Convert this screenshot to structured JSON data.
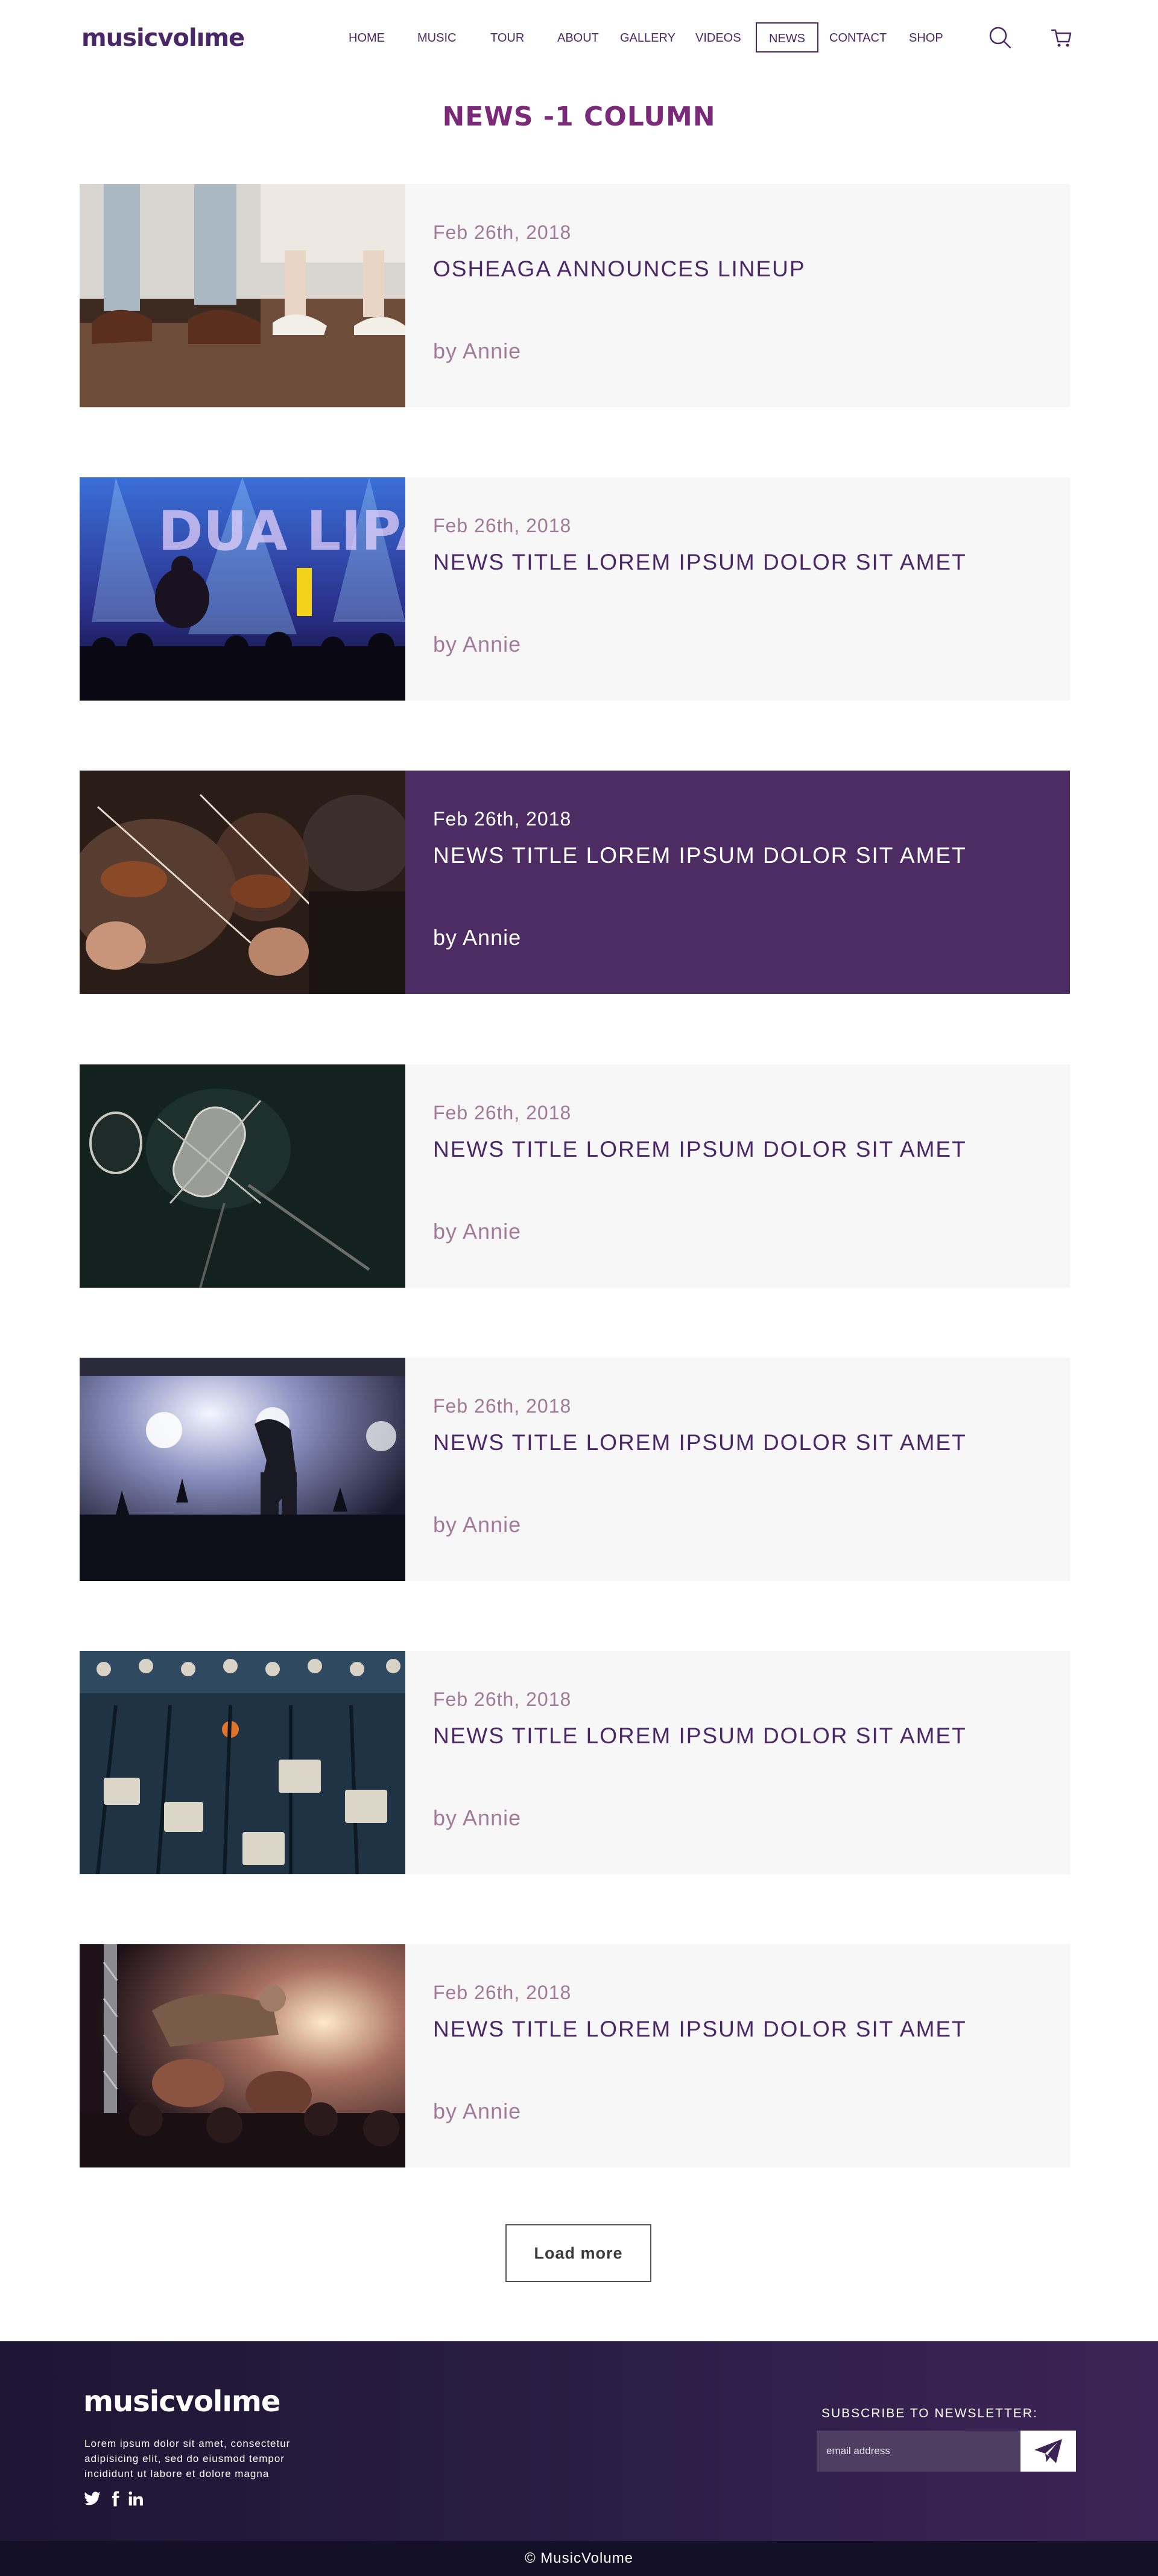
{
  "header": {
    "logo": "musicvolıme",
    "nav": [
      "HOME",
      "MUSIC",
      "TOUR",
      "ABOUT",
      "GALLERY",
      "VIDEOS",
      "NEWS",
      "CONTACT",
      "SHOP"
    ],
    "active_nav": "NEWS",
    "icons": [
      "search-icon",
      "cart-icon"
    ]
  },
  "page_title": "NEWS -1 COLUMN",
  "articles": [
    {
      "date": "Feb 26th, 2018",
      "title": "OSHEAGA ANNOUNCES LINEUP",
      "author": "by Annie",
      "image": "dancing-shoes-photo"
    },
    {
      "date": "Feb 26th, 2018",
      "title": "NEWS TITLE LOREM IPSUM DOLOR SIT AMET",
      "author": "by Annie",
      "image": "concert-crowd-photo"
    },
    {
      "date": "Feb 26th, 2018",
      "title": "NEWS TITLE LOREM IPSUM DOLOR SIT AMET",
      "author": "by Annie",
      "image": "violinists-photo",
      "highlighted": true
    },
    {
      "date": "Feb 26th, 2018",
      "title": "NEWS TITLE LOREM IPSUM DOLOR SIT AMET",
      "author": "by Annie",
      "image": "studio-microphone-photo"
    },
    {
      "date": "Feb 26th, 2018",
      "title": "NEWS TITLE LOREM IPSUM DOLOR SIT AMET",
      "author": "by Annie",
      "image": "stage-performer-photo"
    },
    {
      "date": "Feb 26th, 2018",
      "title": "NEWS TITLE LOREM IPSUM DOLOR SIT AMET",
      "author": "by Annie",
      "image": "mixing-console-photo"
    },
    {
      "date": "Feb 26th, 2018",
      "title": "NEWS TITLE LOREM IPSUM DOLOR SIT AMET",
      "author": "by Annie",
      "image": "crowd-surfing-photo"
    }
  ],
  "load_more_label": "Load more",
  "footer": {
    "logo": "musicvolıme",
    "text": "Lorem ipsum dolor sit amet, consectetur adipisicing elit, sed do eiusmod tempor incididunt ut labore et dolore magna",
    "social_icons": [
      "twitter-icon",
      "facebook-icon",
      "linkedin-icon"
    ],
    "subscribe_label": "SUBSCRIBE TO NEWSLETTER:",
    "email_placeholder": "email address",
    "send_icon": "paper-plane-icon",
    "copyright": "© MusicVolume"
  },
  "colors": {
    "brand": "#4a2766",
    "title": "#7a2a78",
    "meta": "#a07a98",
    "highlight_card": "#4d2c63",
    "card_bg": "#f7f7f7",
    "footer_bg": "#2a1d45"
  }
}
